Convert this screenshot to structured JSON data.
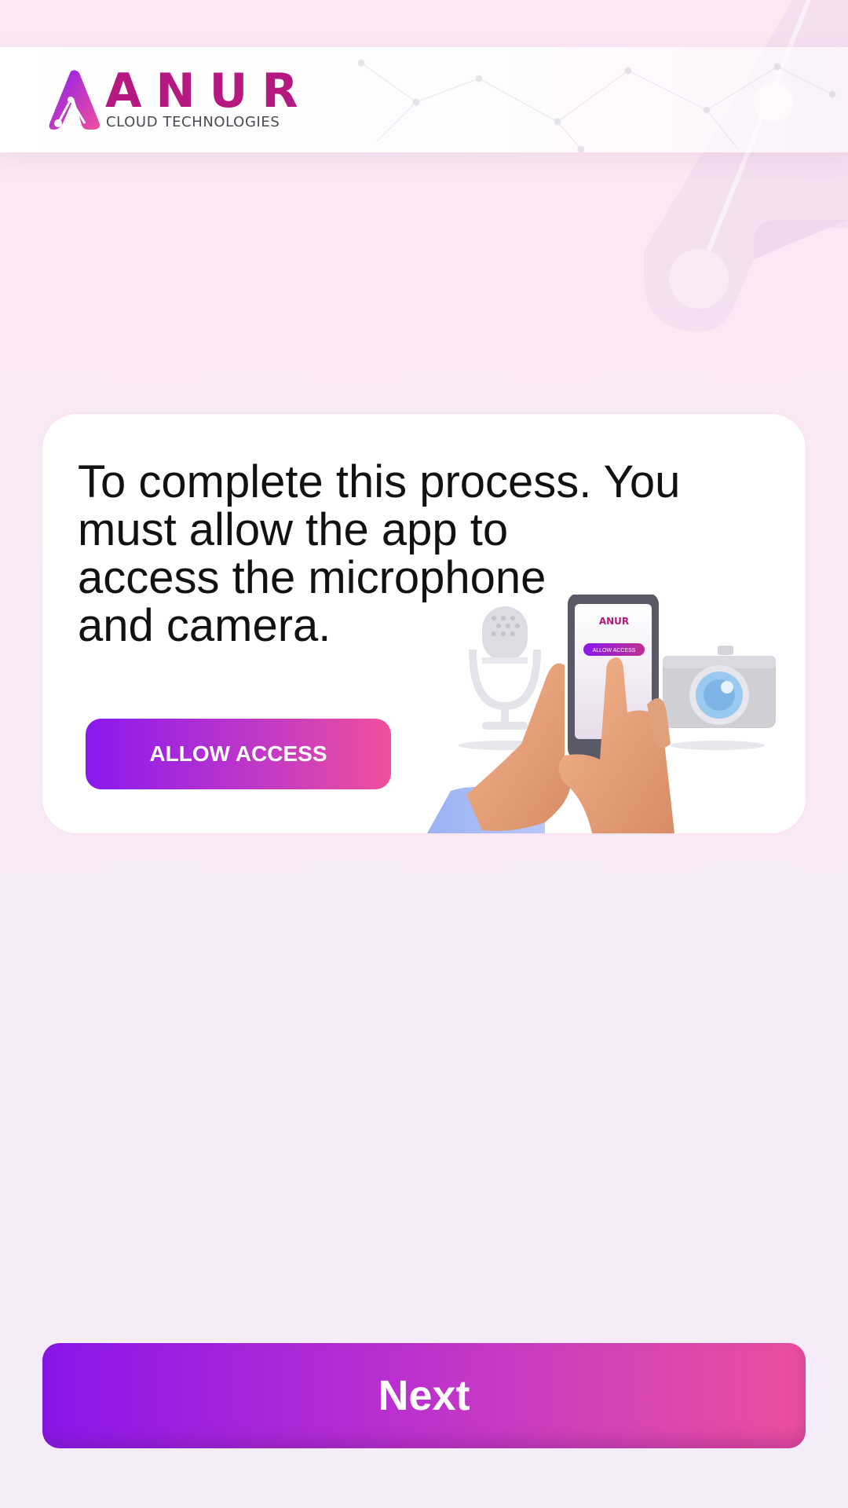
{
  "brand": {
    "name": "ANUR",
    "tagline": "CLOUD TECHNOLOGIES",
    "colors": {
      "primary": "#b5197f",
      "gradient_start": "#8a18ee",
      "gradient_end": "#f04f9b"
    }
  },
  "card": {
    "message_lines": [
      "To complete this process. You",
      "must allow the app to",
      "access the microphone",
      "and camera."
    ],
    "allow_button_label": "ALLOW ACCESS",
    "illustration": {
      "phone_brand": "ANUR",
      "phone_button_label": "ALLOW ACCESS",
      "icons": [
        "microphone-icon",
        "hand-holding-phone-icon",
        "camera-icon"
      ]
    }
  },
  "footer": {
    "next_label": "Next"
  }
}
